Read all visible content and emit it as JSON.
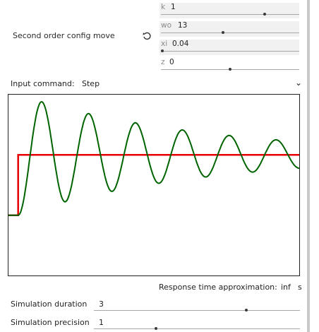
{
  "config": {
    "title": "Second order config move",
    "reset_icon": "reset-icon",
    "params": [
      {
        "label": "k",
        "value": "1",
        "fraction": 0.75
      },
      {
        "label": "wo",
        "value": "13",
        "fraction": 0.45
      },
      {
        "label": "xi",
        "value": "0.04",
        "fraction": 0.01
      },
      {
        "label": "z",
        "value": "0",
        "fraction": 0.5
      }
    ]
  },
  "input_command": {
    "label": "Input command:",
    "selected": "Step",
    "chevron_icon": "chevron-down-icon"
  },
  "response": {
    "label": "Response time approximation:",
    "value": "inf",
    "unit": "s"
  },
  "simulation": {
    "duration_label": "Simulation duration",
    "duration_value": "3",
    "duration_fraction": 0.74,
    "precision_label": "Simulation precision",
    "precision_value": "1",
    "precision_fraction": 0.3
  },
  "colors": {
    "step": "#e60000",
    "response": "#006400"
  },
  "chart_data": {
    "type": "line",
    "title": "",
    "xlabel": "",
    "ylabel": "",
    "grid": false,
    "series": [
      {
        "kind": "step",
        "step_at": 0.1,
        "value": 1
      },
      {
        "kind": "second-order-response",
        "k": 1,
        "wo": 13,
        "xi": 0.04,
        "t_start": 0.1,
        "duration": 3
      }
    ]
  }
}
